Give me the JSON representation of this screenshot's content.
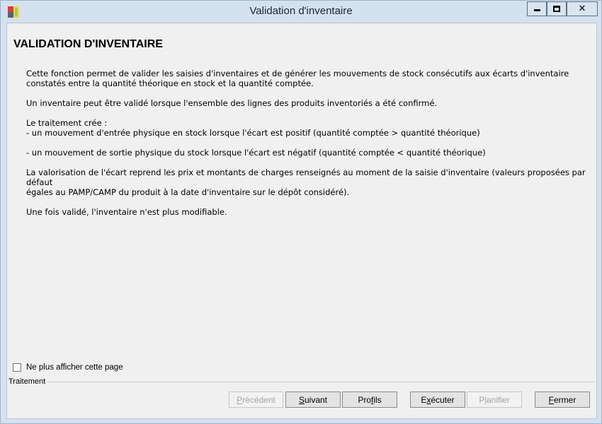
{
  "window": {
    "title": "Validation d'inventaire",
    "icon": "app-icon",
    "controls": {
      "minimize": "minimize-icon",
      "maximize": "maximize-icon",
      "close": "close-icon"
    }
  },
  "content": {
    "heading": "VALIDATION D'INVENTAIRE",
    "paragraphs": {
      "p1_line1": "Cette fonction permet de valider les saisies d'inventaires et de générer les mouvements de stock consécutifs aux écarts d'inventaire",
      "p1_line2": "constatés entre la quantité théorique en stock et la quantité comptée.",
      "p2": "Un inventaire peut être validé lorsque l'ensemble des lignes des produits inventoriés a été confirmé.",
      "p3_line1": "Le traitement crée :",
      "p3_line2": "- un mouvement d'entrée physique en stock lorsque l'écart est positif (quantité comptée > quantité théorique)",
      "p4": "- un mouvement de sortie physique du stock lorsque l'écart est négatif (quantité comptée < quantité théorique)",
      "p5_line1": "La valorisation de l'écart reprend les prix et montants de charges renseignés au moment de la saisie d'inventaire (valeurs proposées par défaut",
      "p5_line2": "égales au PAMP/CAMP du produit à la date d'inventaire sur le dépôt considéré).",
      "p6": "Une fois validé, l'inventaire n'est plus modifiable."
    }
  },
  "footer": {
    "checkbox_label": "Ne plus afficher cette page",
    "checkbox_checked": false,
    "group_label": "Traitement",
    "buttons": {
      "previous": {
        "mn": "P",
        "rest": "récédent",
        "enabled": false
      },
      "next": {
        "mn": "S",
        "rest": "uivant",
        "enabled": true
      },
      "profiles_pre": "Pro",
      "profiles_mn": "f",
      "profiles_post": "ils",
      "execute_pre": "E",
      "execute_mn": "x",
      "execute_post": "écuter",
      "plan": {
        "pre": "P",
        "mn": "l",
        "post": "anifier",
        "enabled": false
      },
      "close": {
        "mn": "F",
        "rest": "ermer",
        "enabled": true
      }
    }
  }
}
